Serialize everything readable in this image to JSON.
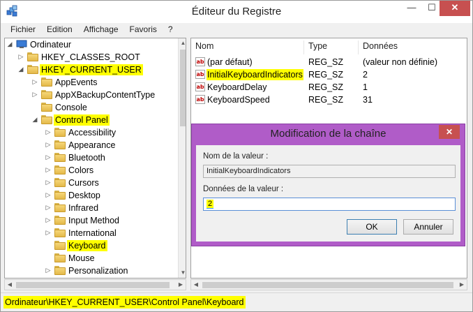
{
  "window": {
    "title": "Éditeur du Registre"
  },
  "menu": [
    "Fichier",
    "Edition",
    "Affichage",
    "Favoris",
    "?"
  ],
  "tree": {
    "root": "Ordinateur",
    "nodes": [
      {
        "label": "HKEY_CLASSES_ROOT",
        "highlight": false
      },
      {
        "label": "HKEY_CURRENT_USER",
        "highlight": true
      },
      {
        "label": "AppEvents",
        "highlight": false
      },
      {
        "label": "AppXBackupContentType",
        "highlight": false
      },
      {
        "label": "Console",
        "highlight": false
      },
      {
        "label": "Control Panel",
        "highlight": true
      },
      {
        "label": "Accessibility",
        "highlight": false
      },
      {
        "label": "Appearance",
        "highlight": false
      },
      {
        "label": "Bluetooth",
        "highlight": false
      },
      {
        "label": "Colors",
        "highlight": false
      },
      {
        "label": "Cursors",
        "highlight": false
      },
      {
        "label": "Desktop",
        "highlight": false
      },
      {
        "label": "Infrared",
        "highlight": false
      },
      {
        "label": "Input Method",
        "highlight": false
      },
      {
        "label": "International",
        "highlight": false
      },
      {
        "label": "Keyboard",
        "highlight": true
      },
      {
        "label": "Mouse",
        "highlight": false
      },
      {
        "label": "Personalization",
        "highlight": false
      }
    ]
  },
  "list": {
    "columns": [
      "Nom",
      "Type",
      "Données"
    ],
    "rows": [
      {
        "name": "(par défaut)",
        "type": "REG_SZ",
        "data": "(valeur non définie)"
      },
      {
        "name": "InitialKeyboardIndicators",
        "type": "REG_SZ",
        "data": "2"
      },
      {
        "name": "KeyboardDelay",
        "type": "REG_SZ",
        "data": "1"
      },
      {
        "name": "KeyboardSpeed",
        "type": "REG_SZ",
        "data": "31"
      }
    ]
  },
  "dialog": {
    "title": "Modification de la chaîne",
    "name_label": "Nom de la valeur :",
    "name_value": "InitialKeyboardIndicators",
    "data_label": "Données de la valeur :",
    "data_value": "2",
    "ok_label": "OK",
    "cancel_label": "Annuler"
  },
  "status": {
    "path": "Ordinateur\\HKEY_CURRENT_USER\\Control Panel\\Keyboard"
  },
  "colors": {
    "highlight": "#ffff00",
    "dialog_frame": "#b05cc8",
    "close_button": "#c75050"
  }
}
